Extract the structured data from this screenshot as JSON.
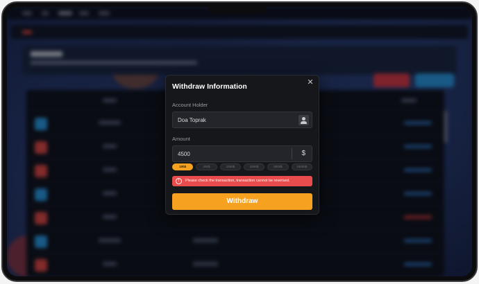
{
  "modal": {
    "title": "Withdraw Information",
    "close_icon": "close-icon",
    "account_holder_label": "Account Holder",
    "account_holder_value": "Doa Toprak",
    "account_holder_icon": "user-icon",
    "amount_label": "Amount",
    "amount_value": "4500",
    "currency_symbol": "$",
    "presets": [
      "100$",
      "200$",
      "1000$",
      "2000$",
      "5000$",
      "10000$"
    ],
    "active_preset_index": 0,
    "warning_icon": "info-icon",
    "warning_text": "Please check the transaction, transaction cannot be reversed.",
    "withdraw_label": "Withdraw"
  },
  "colors": {
    "accent": "#f6a11f",
    "warning": "#e84c4c",
    "modal_bg": "#16171a"
  }
}
